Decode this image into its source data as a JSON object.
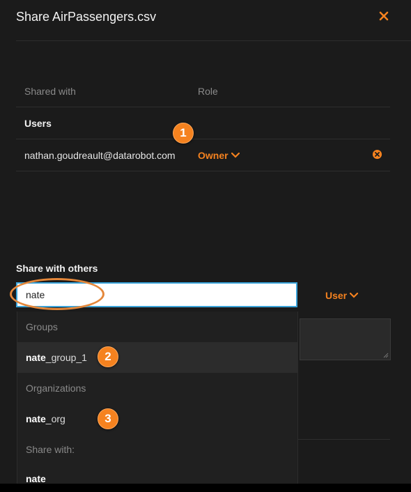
{
  "dialog": {
    "title": "Share AirPassengers.csv",
    "close_icon": "close-icon",
    "accent_color": "#f5821f"
  },
  "shared_table": {
    "columns": [
      "Shared with",
      "Role"
    ],
    "section_title": "Users",
    "rows": [
      {
        "email": "nathan.goudreault@datarobot.com",
        "role": "Owner"
      }
    ]
  },
  "share_with_others": {
    "label": "Share with others",
    "search_value": "nate",
    "type_value": "User"
  },
  "dropdown": {
    "groups_header": "Groups",
    "group_item_match": "nate",
    "group_item_rest": "_group_1",
    "orgs_header": "Organizations",
    "org_item_match": "nate",
    "org_item_rest": "_org",
    "share_header": "Share with:",
    "share_item": "nate"
  },
  "callouts": [
    "1",
    "2",
    "3"
  ]
}
